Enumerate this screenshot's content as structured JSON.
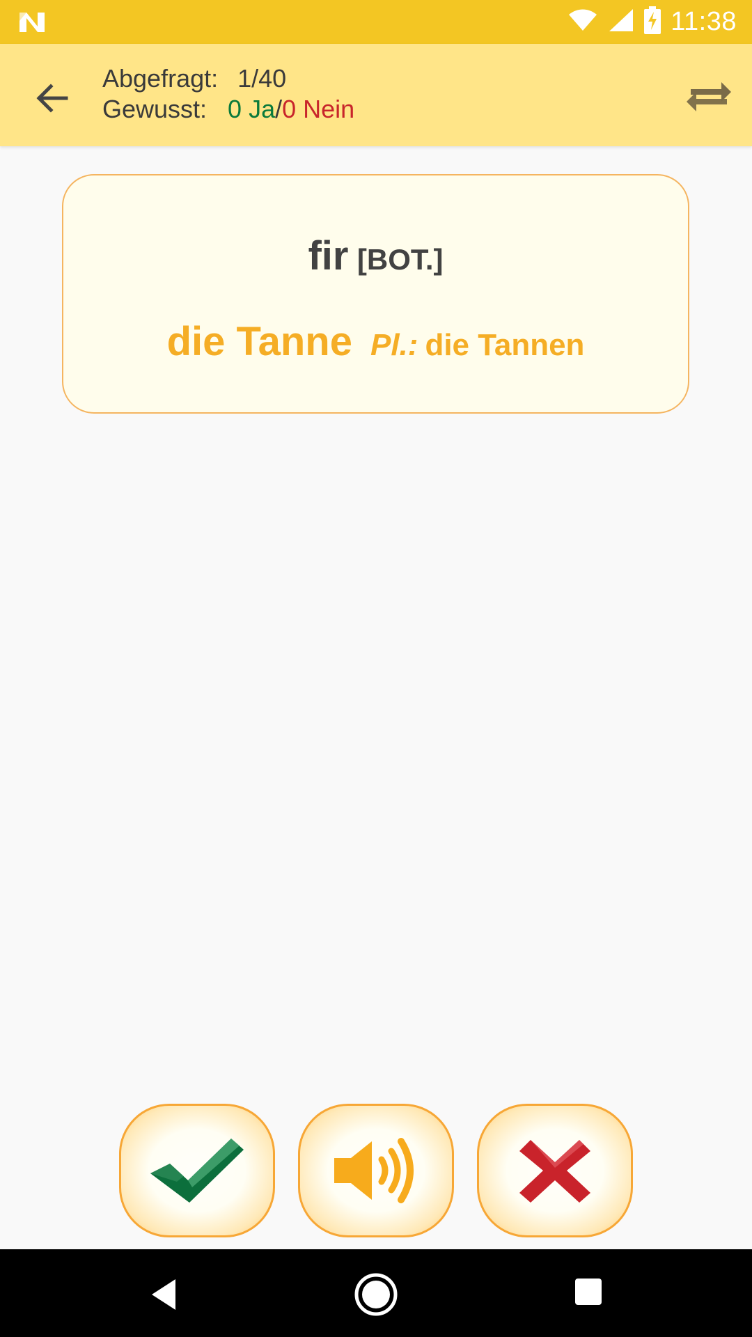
{
  "status_bar": {
    "time": "11:38",
    "icons": [
      "notification-n-icon",
      "wifi-icon",
      "signal-icon",
      "battery-charging-icon"
    ]
  },
  "toolbar": {
    "back_icon": "arrow-back-icon",
    "swap_icon": "swap-direction-icon",
    "queried_label": "Abgefragt:",
    "queried_value": "1/40",
    "known_label": "Gewusst:",
    "yes_text": "0 Ja",
    "separator": "/",
    "no_text": "0 Nein"
  },
  "card": {
    "term": "fir",
    "term_tag": "[BOT.]",
    "translation": "die Tanne",
    "plural_label": "Pl.:",
    "plural": "die Tannen"
  },
  "actions": {
    "yes_icon": "checkmark-icon",
    "sound_icon": "speaker-icon",
    "no_icon": "cross-icon"
  },
  "nav_bar": {
    "icons": [
      "nav-back-icon",
      "nav-home-icon",
      "nav-recents-icon"
    ]
  },
  "colors": {
    "status_bar": "#f3c623",
    "toolbar": "#ffe588",
    "yes": "#0a7a3b",
    "no": "#c8252b",
    "accent": "#f5ad25",
    "card_border": "#f5b560"
  }
}
